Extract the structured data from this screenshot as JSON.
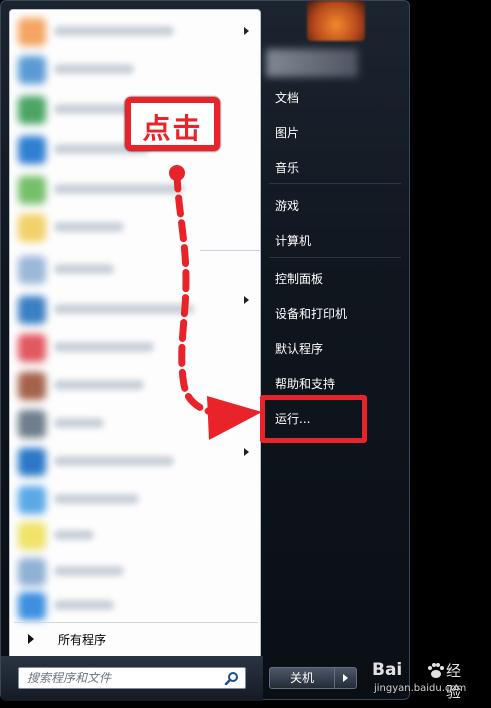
{
  "right_pane": {
    "items": [
      {
        "label": "文档"
      },
      {
        "label": "图片"
      },
      {
        "label": "音乐"
      },
      {
        "label": "游戏"
      },
      {
        "label": "计算机"
      },
      {
        "label": "控制面板"
      },
      {
        "label": "设备和打印机"
      },
      {
        "label": "默认程序"
      },
      {
        "label": "帮助和支持"
      },
      {
        "label": "运行..."
      }
    ]
  },
  "left_pane": {
    "all_programs_label": "所有程序"
  },
  "search": {
    "placeholder": "搜索程序和文件"
  },
  "shutdown": {
    "label": "关机"
  },
  "annotation": {
    "callout_text": "点击",
    "color": "#e8232a"
  },
  "watermark": {
    "brand_logo": "Bai",
    "brand_name": "经验",
    "url": "jingyan.baidu.com"
  }
}
